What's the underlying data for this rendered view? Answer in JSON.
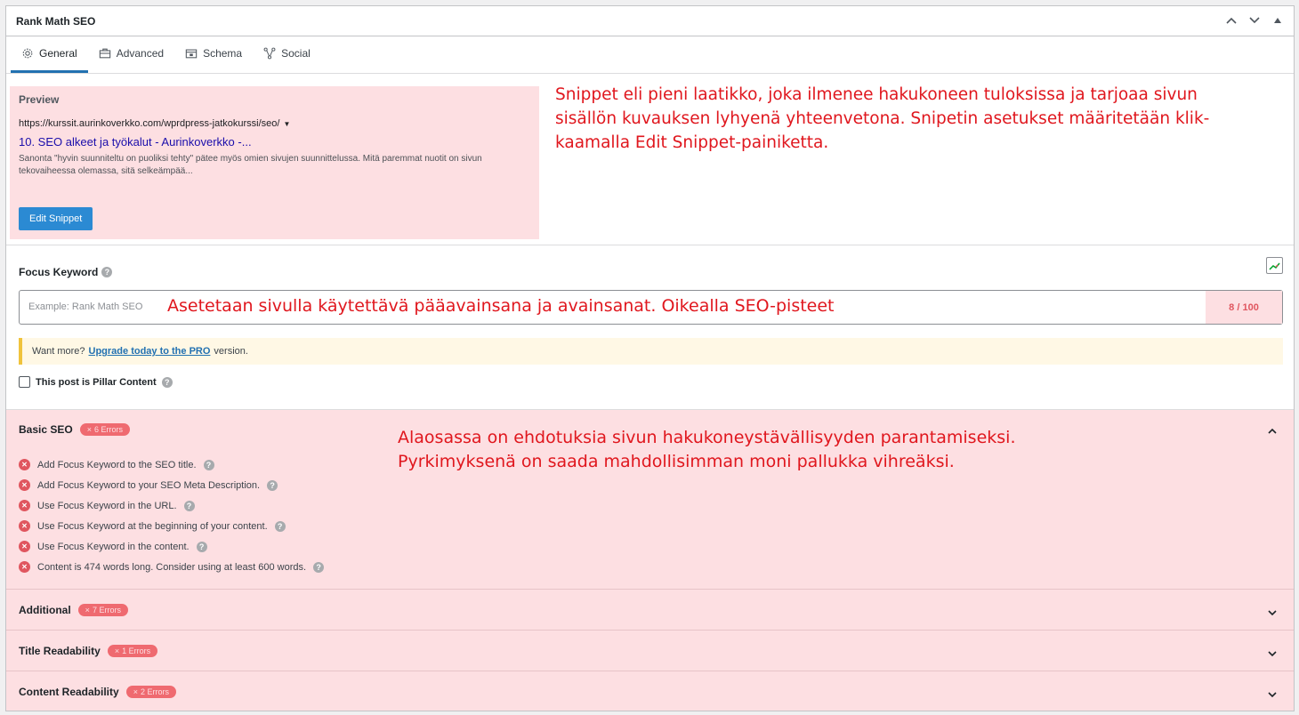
{
  "header": {
    "title": "Rank Math SEO"
  },
  "tabs": [
    {
      "label": "General",
      "icon": "gear-icon",
      "active": true
    },
    {
      "label": "Advanced",
      "icon": "toolbox-icon"
    },
    {
      "label": "Schema",
      "icon": "schema-icon"
    },
    {
      "label": "Social",
      "icon": "social-icon"
    }
  ],
  "preview": {
    "label": "Preview",
    "url": "https://kurssit.aurinkoverkko.com/wprdpress-jatkokurssi/seo/",
    "title": "10. SEO alkeet ja työkalut - Aurinkoverkko -...",
    "description": "Sanonta \"hyvin suunniteltu on puoliksi tehty\" pätee myös omien sivujen suunnittelussa. Mitä paremmat nuotit on sivun tekovaiheessa olemassa, sitä selkeämpää...",
    "edit_button": "Edit Snippet"
  },
  "annotations": {
    "snippet_line1": "Snippet eli pieni laatikko, joka ilmenee hakukoneen tuloksissa ja tarjoaa sivun",
    "snippet_line2": "sisällön kuvauksen lyhyenä yhteenvetona. Snipetin asetukset määritetään klik-",
    "snippet_line3": "kaamalla Edit Snippet-painiketta.",
    "keyword": "Asetetaan sivulla käytettävä pääavainsana ja avainsanat. Oikealla SEO-pisteet",
    "tests_line1": "Alaosassa on ehdotuksia sivun hakukoneystävällisyyden parantamiseksi.",
    "tests_line2": "Pyrkimyksenä on saada mahdollisimman moni pallukka vihreäksi."
  },
  "focus_keyword": {
    "label": "Focus Keyword",
    "placeholder": "Example: Rank Math SEO",
    "score": "8 / 100"
  },
  "upgrade": {
    "prefix": "Want more?",
    "link": "Upgrade today to the PRO",
    "suffix": "version."
  },
  "pillar": {
    "label": "This post is Pillar Content"
  },
  "sections": {
    "basic": {
      "title": "Basic SEO",
      "badge": "6 Errors",
      "tests": [
        "Add Focus Keyword to the SEO title.",
        "Add Focus Keyword to your SEO Meta Description.",
        "Use Focus Keyword in the URL.",
        "Use Focus Keyword at the beginning of your content.",
        "Use Focus Keyword in the content.",
        "Content is 474 words long. Consider using at least 600 words."
      ]
    },
    "additional": {
      "title": "Additional",
      "badge": "7 Errors"
    },
    "title_readability": {
      "title": "Title Readability",
      "badge": "1 Errors"
    },
    "content_readability": {
      "title": "Content Readability",
      "badge": "2 Errors"
    }
  },
  "colors": {
    "accent": "#2271b1",
    "error": "#e0565f",
    "annotation": "#e0171e",
    "highlight": "#fddfe2"
  }
}
